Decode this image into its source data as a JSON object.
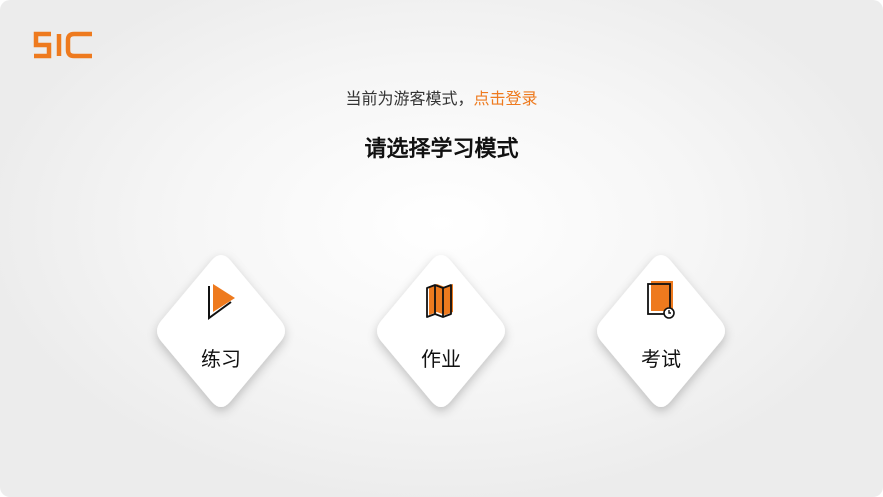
{
  "app": {
    "logo_text": "51C",
    "accent_color": "#ee7a1e"
  },
  "header": {
    "guest_prefix": "当前为游客模式，",
    "login_link": "点击登录",
    "title": "请选择学习模式"
  },
  "modes": [
    {
      "label": "练习",
      "icon": "play-icon"
    },
    {
      "label": "作业",
      "icon": "folded-map-icon"
    },
    {
      "label": "考试",
      "icon": "exam-document-clock-icon"
    }
  ]
}
